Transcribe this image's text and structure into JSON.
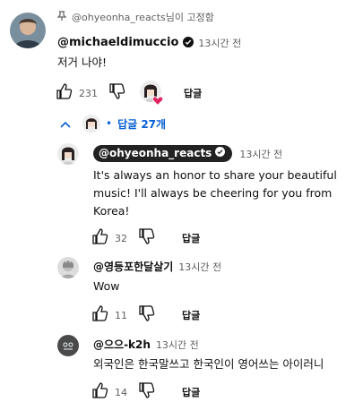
{
  "pinned": {
    "text": "@ohyeonha_reacts님이 고정함",
    "icon": "pin-icon"
  },
  "top_comment": {
    "author": "@michaeldimuccio",
    "verified": true,
    "time": "13시간 전",
    "text": "저거 나야!",
    "likes": "231",
    "reply_label": "답글",
    "hearted": true
  },
  "replies_toggle": {
    "label": "답글 27개",
    "icon": "chevron-up-icon"
  },
  "replies": [
    {
      "author": "@ohyeonha_reacts",
      "verified": true,
      "highlighted": true,
      "time": "13시간 전",
      "text": "It's always an honor to share your beautiful music! I'll always be cheering for you from Korea!",
      "likes": "32",
      "reply_label": "답글"
    },
    {
      "author": "@영등포한달살기",
      "time": "13시간 전",
      "text": "Wow",
      "likes": "11",
      "reply_label": "답글"
    },
    {
      "author": "@으으-k2h",
      "time": "13시간 전",
      "text": "외국인은 한국말쓰고 한국인이 영어쓰는 아이러니",
      "likes": "14",
      "reply_label": "답글"
    }
  ],
  "colors": {
    "link_blue": "#065fd4",
    "heart_red": "#e0245e",
    "chip_bg": "#222222",
    "muted": "#606060"
  }
}
